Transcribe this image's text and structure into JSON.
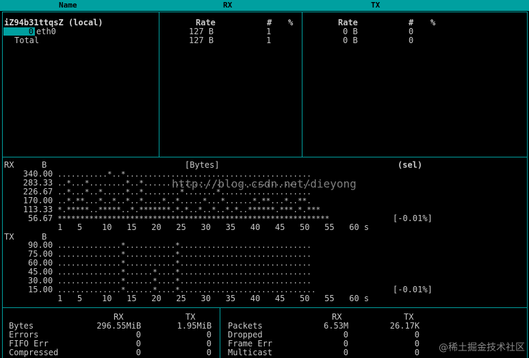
{
  "header": {
    "name": "Name",
    "rx": "RX",
    "tx": "TX"
  },
  "iface_table": {
    "host": "iZ94b31ttqsZ (local)",
    "selected_count": "0",
    "iface": "eth0",
    "total_label": "Total",
    "rx_cols": {
      "rate": "Rate",
      "count": "#",
      "pct": "%"
    },
    "tx_cols": {
      "rate": "Rate",
      "count": "#",
      "pct": "%"
    },
    "eth0": {
      "rx_rate": "127 B",
      "rx_count": "1",
      "tx_rate": "0 B",
      "tx_count": "0"
    },
    "total": {
      "rx_rate": "127 B",
      "rx_count": "1",
      "tx_rate": "0 B",
      "tx_count": "0"
    }
  },
  "graph": {
    "rx_label": "RX",
    "tx_label": "TX",
    "unit": "B",
    "title": "[Bytes]",
    "sel": "(sel)",
    "rx_levels": [
      "340.00",
      "283.33",
      "226.67",
      "170.00",
      "113.33",
      "56.67"
    ],
    "tx_levels": [
      "90.00",
      "75.00",
      "60.00",
      "45.00",
      "30.00",
      "15.00"
    ],
    "rx_rows": [
      "...........*..*.........................................",
      "..*...*........*..*.....................................",
      "..*...*..*.....*..*........*.......*....................",
      "..*.**...*..*..*..*....*..*.....*...*......*.**...*..**.",
      "*.*****..*****..*.*******.*.*..*..*..*.*..******.***.*.***",
      "************************************************************"
    ],
    "tx_rows": [
      "..............*...........*.............................",
      "..............*...........*.............................",
      "..............*...........*.............................",
      "..............*......*....*.............................",
      "..............*......*....*.............................",
      "..............*......*....*.............................."
    ],
    "rx_pct": "[-0.01%]",
    "tx_pct": "[-0.01%]",
    "x_axis": "1   5    10   15   20   25   30   35   40   45   50   55   60 s",
    "watermark": "http://blog.csdn.net/dieyong"
  },
  "stats": {
    "rx_head": "RX",
    "tx_head": "TX",
    "left": [
      {
        "label": "Bytes",
        "rx": "296.55MiB",
        "tx": "1.95MiB"
      },
      {
        "label": "Errors",
        "rx": "0",
        "tx": "0"
      },
      {
        "label": "FIFO Err",
        "rx": "0",
        "tx": "0"
      },
      {
        "label": "Compressed",
        "rx": "0",
        "tx": "0"
      }
    ],
    "right": [
      {
        "label": "Packets",
        "rx": "6.53M",
        "tx": "26.17K"
      },
      {
        "label": "Dropped",
        "rx": "0",
        "tx": "0"
      },
      {
        "label": "Frame Err",
        "rx": "0",
        "tx": "0"
      },
      {
        "label": "Multicast",
        "rx": "0",
        "tx": "0"
      }
    ]
  },
  "footer_watermark": "@稀土掘金技术社区",
  "colors": {
    "accent": "#00a0a0",
    "text": "#c8c8c8",
    "bg": "#000000"
  }
}
